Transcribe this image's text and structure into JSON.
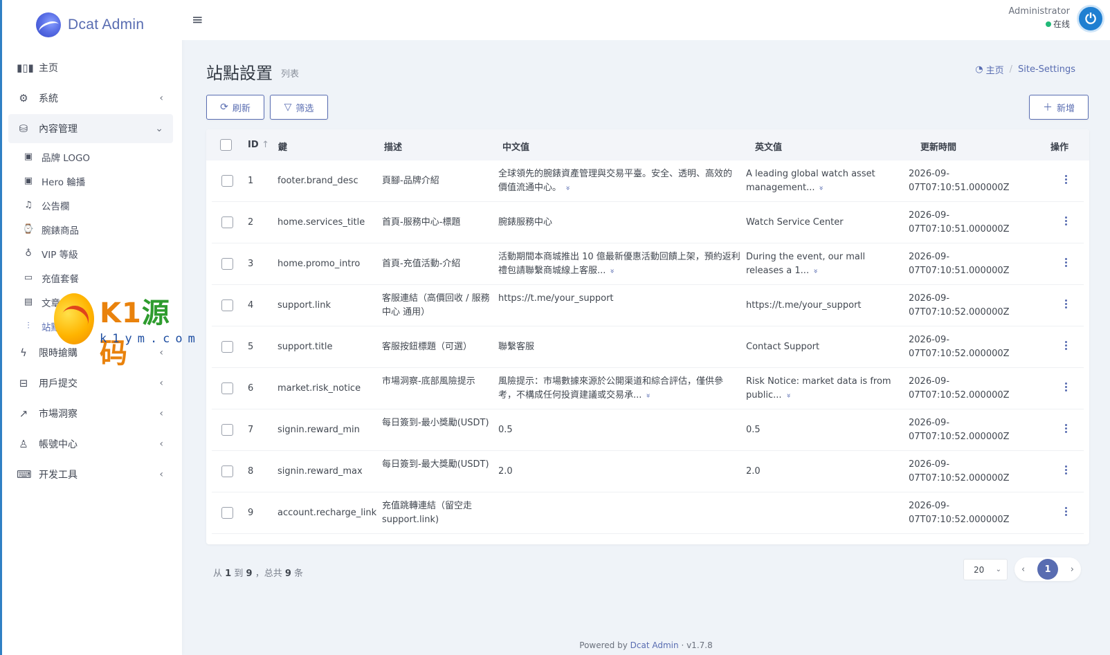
{
  "brand": {
    "name": "Dcat Admin"
  },
  "sidebar": {
    "items": [
      {
        "label": "主页",
        "icon": "bar-chart-icon"
      },
      {
        "label": "系統",
        "icon": "gear-icon"
      },
      {
        "label": "內容管理",
        "icon": "database-icon"
      }
    ],
    "submenu": [
      {
        "label": "品牌 LOGO",
        "icon": "image-icon"
      },
      {
        "label": "Hero 輪播",
        "icon": "image-icon"
      },
      {
        "label": "公告欄",
        "icon": "bell-icon"
      },
      {
        "label": "腕錶商品",
        "icon": "watch-icon"
      },
      {
        "label": "VIP 等級",
        "icon": "award-icon"
      },
      {
        "label": "充值套餐",
        "icon": "credit-card-icon"
      },
      {
        "label": "文章",
        "icon": "file-icon"
      },
      {
        "label": "站點設置",
        "icon": "sliders-icon"
      }
    ],
    "items_after": [
      {
        "label": "限時搶購",
        "icon": "lightning-icon"
      },
      {
        "label": "用戶提交",
        "icon": "inbox-icon"
      },
      {
        "label": "市場洞察",
        "icon": "trending-up-icon"
      },
      {
        "label": "帳號中心",
        "icon": "user-icon"
      },
      {
        "label": "开发工具",
        "icon": "keyboard-icon"
      }
    ]
  },
  "watermark": {
    "brand": "K1源码",
    "sub": "k1ym.com"
  },
  "topbar": {
    "user_name": "Administrator",
    "user_status": "在线"
  },
  "page": {
    "title": "站點設置",
    "subtitle": "列表",
    "breadcrumb_home": "主页",
    "breadcrumb_current": "Site-Settings"
  },
  "toolbar": {
    "refresh": "刷新",
    "filter": "筛选",
    "create": "新增"
  },
  "table": {
    "headers": {
      "id": "ID",
      "key": "鍵",
      "desc": "描述",
      "zh": "中文值",
      "en": "英文值",
      "updated": "更新時間",
      "actions": "操作"
    },
    "rows": [
      {
        "id": "1",
        "key": "footer.brand_desc",
        "desc": "頁腳-品牌介紹",
        "zh": "全球領先的腕錶資產管理與交易平臺。安全、透明、高效的價值流通中心。",
        "en": "A leading global watch asset management...",
        "date": "2026-09-",
        "time": "07T07:10:51.000000Z"
      },
      {
        "id": "2",
        "key": "home.services_title",
        "desc": "首頁-服務中心-標題",
        "zh": "腕錶服務中心",
        "en": "Watch Service Center",
        "date": "2026-09-",
        "time": "07T07:10:51.000000Z"
      },
      {
        "id": "3",
        "key": "home.promo_intro",
        "desc": "首頁-充值活動-介紹",
        "zh": "活動期間本商城推出 10 億最新優惠活動回饋上架，預約返利禮包請聯繫商城線上客服...",
        "en": "During the event, our mall releases a 1...",
        "date": "2026-09-",
        "time": "07T07:10:51.000000Z"
      },
      {
        "id": "4",
        "key": "support.link",
        "desc": "客服連結（高價回收 / 服務中心 通用）",
        "zh": "https://t.me/your_support",
        "en": "https://t.me/your_support",
        "date": "2026-09-",
        "time": "07T07:10:52.000000Z"
      },
      {
        "id": "5",
        "key": "support.title",
        "desc": "客服按鈕標題（可選）",
        "zh": "聯繫客服",
        "en": "Contact Support",
        "date": "2026-09-",
        "time": "07T07:10:52.000000Z"
      },
      {
        "id": "6",
        "key": "market.risk_notice",
        "desc": "市場洞察-底部風險提示",
        "zh": "風險提示：市場數據來源於公開渠道和綜合評估，僅供參考，不構成任何投資建議或交易承...",
        "en": "Risk Notice: market data is from public...",
        "date": "2026-09-",
        "time": "07T07:10:52.000000Z"
      },
      {
        "id": "7",
        "key": "signin.reward_min",
        "desc": "每日簽到-最小獎勵(USDT)",
        "zh": "0.5",
        "en": "0.5",
        "date": "2026-09-",
        "time": "07T07:10:52.000000Z"
      },
      {
        "id": "8",
        "key": "signin.reward_max",
        "desc": "每日簽到-最大獎勵(USDT)",
        "zh": "2.0",
        "en": "2.0",
        "date": "2026-09-",
        "time": "07T07:10:52.000000Z"
      },
      {
        "id": "9",
        "key": "account.recharge_link",
        "desc": "充值跳轉連結（留空走support.link)",
        "zh": "",
        "en": "",
        "date": "2026-09-",
        "time": "07T07:10:52.000000Z"
      }
    ]
  },
  "pagination": {
    "info_prefix": "从",
    "from": "1",
    "to_word": "到",
    "to": "9",
    "total_prefix": "，总共",
    "total": "9",
    "unit": "条",
    "per_page": "20",
    "current": "1"
  },
  "footer": {
    "prefix": "Powered by",
    "link": "Dcat Admin",
    "version": "v1.7.8"
  },
  "colors": {
    "primary": "#586cb1",
    "online": "#21b978"
  }
}
